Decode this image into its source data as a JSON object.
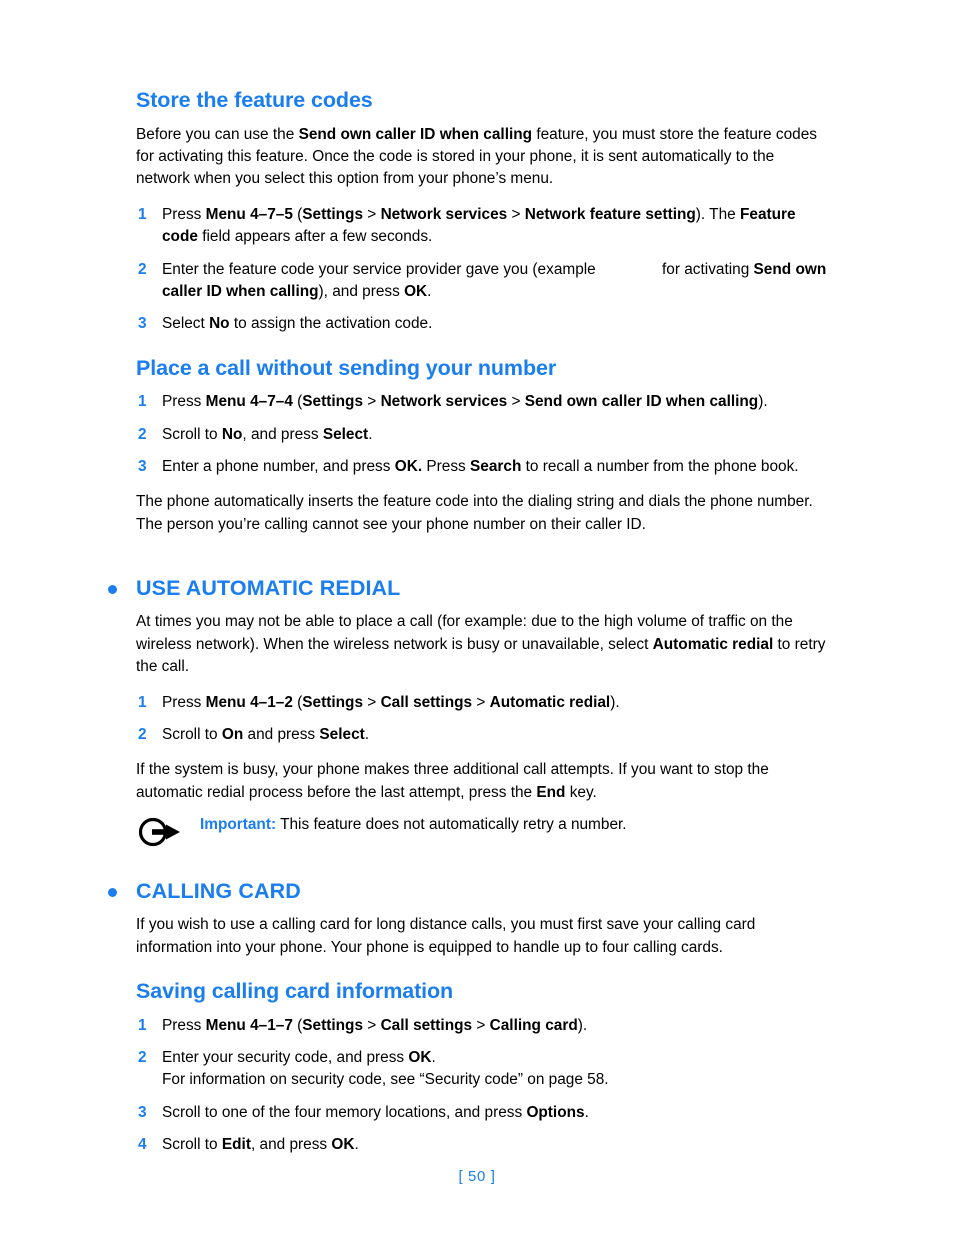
{
  "page": {
    "number_label": "[ 50 ]",
    "accent_color": "#1a7ef0",
    "text_color": "#000000",
    "background_color": "#ffffff"
  },
  "sections": {
    "store_feature_codes": {
      "heading": "Store the feature codes",
      "intro_part1": "Before you can use the ",
      "intro_bold1": "Send own caller ID when calling",
      "intro_part2": " feature, you must store the feature codes for activating this feature. Once the code is stored in your phone, it is sent automatically to the network when you select this option from your phone’s menu.",
      "steps": [
        {
          "num": "1",
          "t1": "Press ",
          "b1": "Menu 4–7–5",
          "t2": " (",
          "b2": "Settings",
          "t3": " > ",
          "b3": "Network services",
          "t4": " > ",
          "b4": "Network feature setting",
          "t5": "). The ",
          "b5": "Feature code",
          "t6": " field appears after a few seconds."
        },
        {
          "num": "2",
          "t1": "Enter the feature code your service provider gave you (example",
          "t2": " for activating ",
          "b1": "Send own caller ID when calling",
          "t3": "), and press ",
          "b2": "OK",
          "t4": "."
        },
        {
          "num": "3",
          "t1": "Select ",
          "b1": "No",
          "t2": " to assign the activation code."
        }
      ]
    },
    "place_call_without_number": {
      "heading": "Place a call without sending your number",
      "steps": [
        {
          "num": "1",
          "t1": "Press ",
          "b1": "Menu 4–7–4",
          "t2": " (",
          "b2": "Settings",
          "t3": " > ",
          "b3": "Network services",
          "t4": " > ",
          "b4": "Send own caller ID when calling",
          "t5": ")."
        },
        {
          "num": "2",
          "t1": "Scroll to ",
          "b1": "No",
          "t2": ", and press ",
          "b2": "Select",
          "t3": "."
        },
        {
          "num": "3",
          "t1": "Enter a phone number, and press ",
          "b1": "OK.",
          "t2": " Press ",
          "b2": "Search",
          "t3": " to recall a number from the phone book."
        }
      ],
      "outro": "The phone automatically inserts the feature code into the dialing string and dials the phone number. The person you’re calling cannot see your phone number on their caller ID."
    },
    "use_automatic_redial": {
      "heading": "USE AUTOMATIC REDIAL",
      "bullet_icon": "bullet-dot-icon",
      "intro_part1": "At times you may not be able to place a call (for example: due to the high volume of traffic on the wireless network). When the wireless network is busy or unavailable, select ",
      "intro_bold1": "Automatic redial",
      "intro_part2": " to retry the call.",
      "steps": [
        {
          "num": "1",
          "t1": "Press ",
          "b1": "Menu 4–1–2",
          "t2": " (",
          "b2": "Settings",
          "t3": " > ",
          "b3": "Call settings",
          "t4": " > ",
          "b4": "Automatic redial",
          "t5": ")."
        },
        {
          "num": "2",
          "t1": "Scroll to ",
          "b1": "On",
          "t2": " and press ",
          "b2": "Select",
          "t3": "."
        }
      ],
      "outro_part1": "If the system is busy, your phone makes three additional call attempts. If you want to stop the automatic redial process before the last attempt, press the ",
      "outro_bold1": "End",
      "outro_part2": " key.",
      "note": {
        "icon": "circle-arrow-note-icon",
        "label": "Important:",
        "text": " This feature does not automatically retry a number."
      }
    },
    "calling_card": {
      "heading": "CALLING CARD",
      "bullet_icon": "bullet-dot-icon",
      "intro": "If you wish to use a calling card for long distance calls, you must first save your calling card information into your phone. Your phone is equipped to handle up to four calling cards.",
      "subsection": {
        "heading": "Saving calling card information",
        "steps": [
          {
            "num": "1",
            "t1": "Press ",
            "b1": "Menu 4–1–7",
            "t2": " (",
            "b2": "Settings",
            "t3": " > ",
            "b3": "Call settings",
            "t4": " > ",
            "b4": "Calling card",
            "t5": ")."
          },
          {
            "num": "2",
            "t1": "Enter your security code, and press ",
            "b1": "OK",
            "t2": ".",
            "line2": "For information on security code, see “Security code” on page 58."
          },
          {
            "num": "3",
            "t1": "Scroll to one of the four memory locations, and press ",
            "b1": "Options",
            "t2": "."
          },
          {
            "num": "4",
            "t1": "Scroll to ",
            "b1": "Edit",
            "t2": ", and press ",
            "b2": "OK",
            "t3": "."
          }
        ]
      }
    }
  }
}
